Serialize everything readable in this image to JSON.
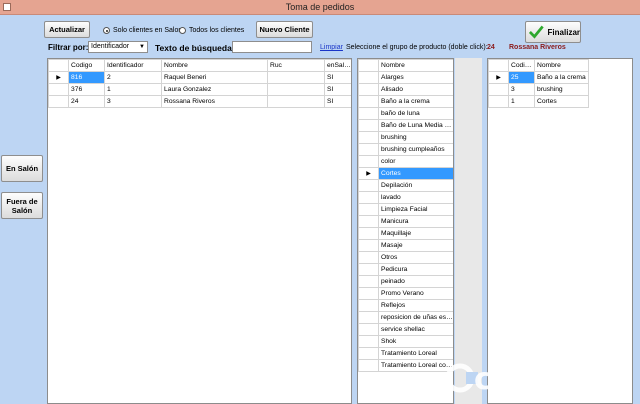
{
  "window": {
    "title": "Toma de pedidos"
  },
  "toolbar": {
    "actualizar_label": "Actualizar",
    "radio_solo_label": "Solo clientes en Salon",
    "radio_todos_label": "Todos los clientes",
    "nuevo_cliente_label": "Nuevo Cliente",
    "finalizar_label": "Finalizar"
  },
  "filter": {
    "filtrar_label": "Filtrar por:",
    "filtrar_value": "Identificador",
    "texto_label": "Texto de búsqueda:",
    "texto_value": "",
    "limpiar_label": "Limpiar",
    "grupo_label": "Seleccione el grupo de producto (doble click):"
  },
  "selected_client": {
    "codigo": "24",
    "nombre": "Rossana Riveros"
  },
  "sidebar": {
    "en_salon_label": "En Salón",
    "fuera_label": "Fuera de Salón"
  },
  "clients_grid": {
    "headers": [
      "Codigo",
      "Identificador",
      "Nombre",
      "Ruc",
      "enSalon"
    ],
    "rows": [
      [
        "816",
        "2",
        "Raquel Beneri",
        "",
        "SI"
      ],
      [
        "376",
        "1",
        "Laura Gonzalez",
        "",
        "SI"
      ],
      [
        "24",
        "3",
        "Rossana Riveros",
        "",
        "SI"
      ]
    ]
  },
  "groups_grid": {
    "header": "Nombre",
    "rows": [
      "Alarges",
      "Alisado",
      "Baño a la crema",
      "baño de luna",
      "Baño de Luna Media Pi...",
      "brushing",
      "brushing cumpleaños",
      "color",
      "Cortes",
      "Depilación",
      "lavado",
      "Limpieza Facial",
      "Manicura",
      "Maquillaje",
      "Masaje",
      "Otros",
      "Pedicura",
      "peinado",
      "Promo Verano",
      "Reflejos",
      "reposicion de uñas esc...",
      "service shellac",
      "Shok",
      "Tratamiento Loreal",
      "Tratamiento Loreal colo..."
    ],
    "selected_index": 8
  },
  "order_grid": {
    "headers": [
      "Codigo",
      "Nombre"
    ],
    "rows": [
      [
        "25",
        "Baño a la crema"
      ],
      [
        "3",
        "brushing"
      ],
      [
        "1",
        "Cortes"
      ]
    ]
  },
  "watermark": {
    "text": "clasipar",
    "suffix": ".com"
  },
  "colors": {
    "background": "#bdd5f3",
    "titlebar": "#e5a491",
    "selection": "#3399ff",
    "client_label": "#8b1a1a",
    "link": "#1a35c8",
    "check": "#2ea82e"
  }
}
